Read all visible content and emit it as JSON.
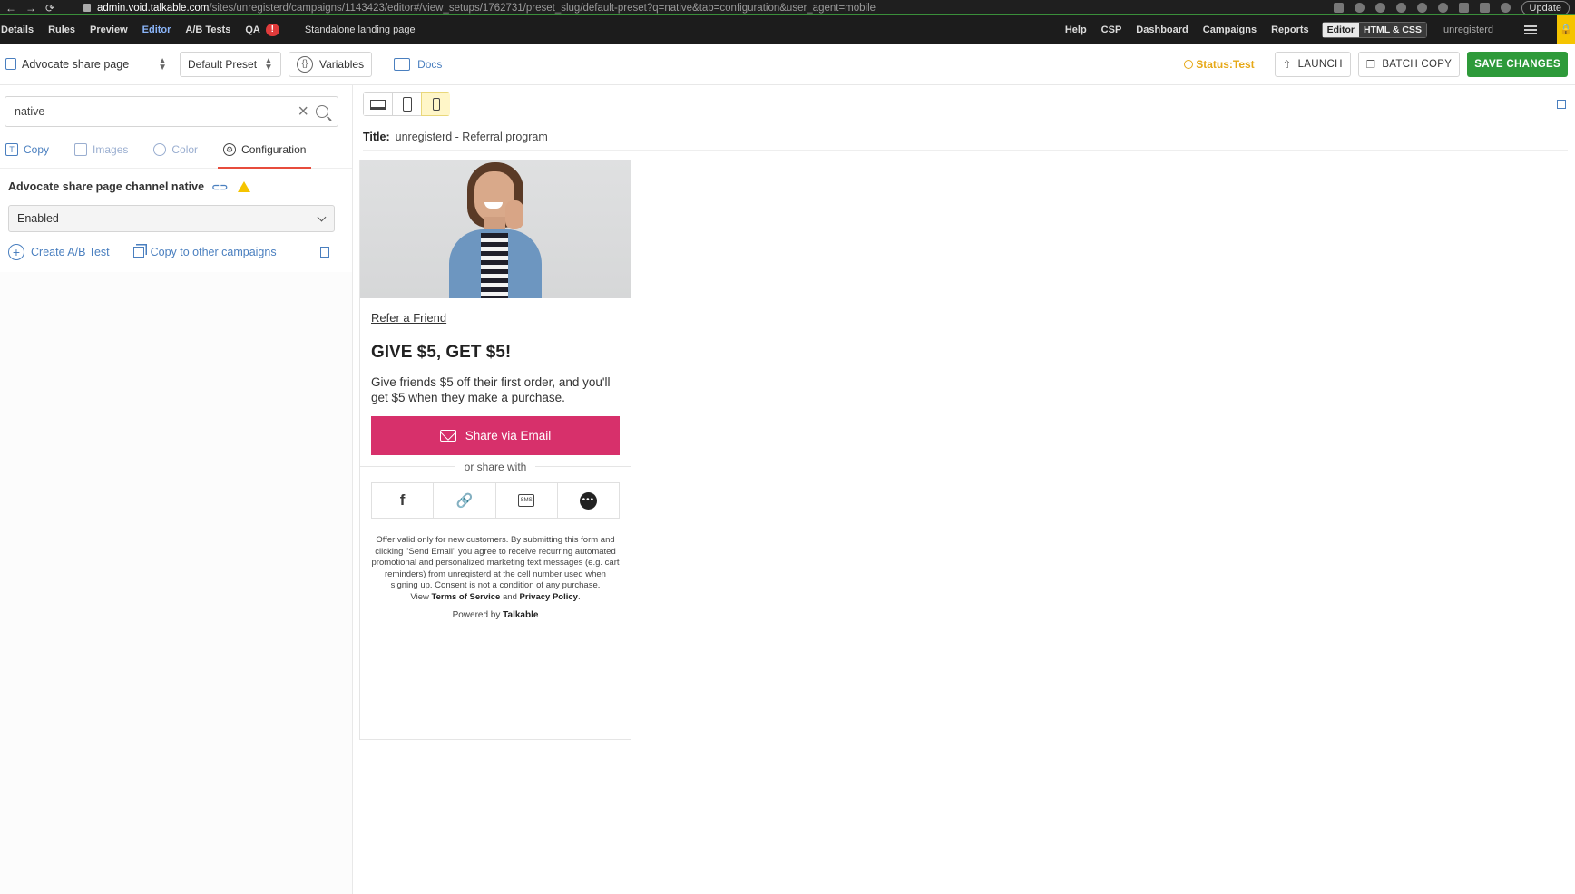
{
  "browser": {
    "url_host": "admin.void.talkable.com",
    "url_path": "/sites/unregisterd/campaigns/1143423/editor#/view_setups/1762731/preset_slug/default-preset?q=native&tab=configuration&user_agent=mobile",
    "update_label": "Update"
  },
  "appnav": {
    "items": [
      "Details",
      "Rules",
      "Preview",
      "Editor",
      "A/B Tests",
      "QA"
    ],
    "qa_badge": "!",
    "standalone": "Standalone landing page",
    "right_items": [
      "Help",
      "CSP",
      "Dashboard",
      "Campaigns",
      "Reports"
    ],
    "segment_on": "Editor",
    "segment_off": "HTML & CSS",
    "user": "unregisterd"
  },
  "toolbar": {
    "page_name": "Advocate share page",
    "preset": "Default Preset",
    "variables": "Variables",
    "docs": "Docs",
    "status": "Status:Test",
    "launch": "LAUNCH",
    "batch_copy": "BATCH COPY",
    "save": "SAVE CHANGES"
  },
  "left": {
    "search_value": "native",
    "tabs": [
      "Copy",
      "Images",
      "Color",
      "Configuration"
    ],
    "setting_label": "Advocate share page channel native",
    "select_value": "Enabled",
    "create_ab": "Create A/B Test",
    "copy_other": "Copy to other campaigns"
  },
  "canvas": {
    "title_label": "Title:",
    "title_value": "unregisterd - Referral program"
  },
  "preview": {
    "refer": "Refer a Friend",
    "headline": "GIVE $5, GET $5!",
    "desc": "Give friends $5 off their first order, and you'll get $5 when they make a purchase.",
    "share_email": "Share via Email",
    "or_share": "or share with",
    "sms": "SMS",
    "legal_line1": "Offer valid only for new customers. By submitting this form and clicking \"Send Email\" you agree to receive recurring automated promotional and personalized marketing text messages (e.g. cart reminders) from unregisterd at the cell number used when signing up. Consent is not a condition of any purchase.",
    "legal_view": "View",
    "terms": "Terms of Service",
    "and": "and",
    "privacy": "Privacy Policy",
    "powered_by": "Powered by",
    "brand": "Talkable"
  },
  "colors": {
    "save": "#2e9a3a",
    "share_button": "#d7306b",
    "status": "#e6a817",
    "link": "#4a7fbf"
  }
}
